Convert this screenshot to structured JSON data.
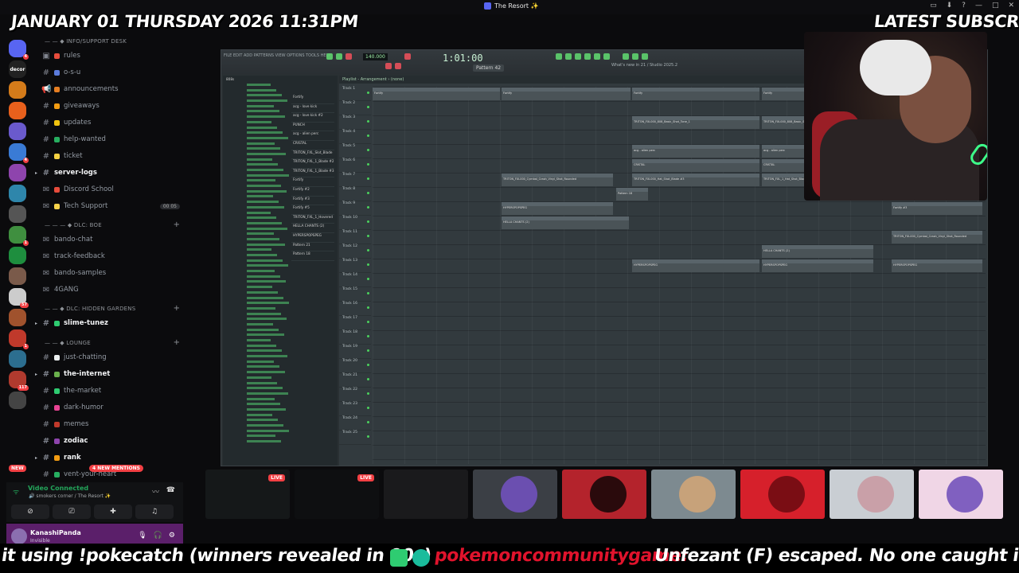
{
  "window": {
    "title": "The Resort ✨"
  },
  "overlay": {
    "datetime": "JANUARY 01 THURSDAY 2026 11:31PM",
    "latest_label": "LATEST SUBSCRI"
  },
  "servers": [
    {
      "icon": "discord-home-icon",
      "color": "#5865f2",
      "badge": "4"
    },
    {
      "icon": "server-decor-icon",
      "color": "#222",
      "label": "decor"
    },
    {
      "icon": "server-gold-icon",
      "color": "#d47b1a"
    },
    {
      "icon": "server-calendar-icon",
      "color": "#e8601c"
    },
    {
      "icon": "server-purple-icon",
      "color": "#6a5acd"
    },
    {
      "icon": "server-blue-icon",
      "color": "#3a7bd5",
      "badge": "4"
    },
    {
      "icon": "server-violet-icon",
      "color": "#8e44ad"
    },
    {
      "icon": "server-teal-icon",
      "color": "#2e86ab"
    },
    {
      "icon": "server-grey-icon",
      "color": "#555"
    },
    {
      "icon": "server-money-icon",
      "color": "#3f8f3f",
      "badge": "1"
    },
    {
      "icon": "server-green-icon",
      "color": "#1e8e3e"
    },
    {
      "icon": "server-face-icon",
      "color": "#7a5a4a"
    },
    {
      "icon": "server-white-icon",
      "color": "#ccc",
      "badge": "57"
    },
    {
      "icon": "server-avatar-icon",
      "color": "#a0522d"
    },
    {
      "icon": "server-fire-icon",
      "color": "#c0392b",
      "badge": "1"
    },
    {
      "icon": "server-ocean-icon",
      "color": "#2c6e8f"
    },
    {
      "icon": "server-game-icon",
      "color": "#b03a2e",
      "badge": "117"
    },
    {
      "icon": "server-dark-icon",
      "color": "#444"
    }
  ],
  "new_pill": "NEW",
  "categories": {
    "info": "INFO/SUPPORT DESK",
    "dlc_boe": "DLC: BOE",
    "dlc_hidden": "DLC: HIDDEN GARDENS",
    "lounge": "LOUNGE"
  },
  "channels": {
    "rules": "rules",
    "osu": "o-s-u",
    "announcements": "announcements",
    "giveaways": "giveaways",
    "updates": "updates",
    "help_wanted": "help-wanted",
    "ticket": "ticket",
    "server_logs": "server-logs",
    "discord_school": "Discord School",
    "tech_support": "Tech Support",
    "tech_support_count": "00 05",
    "bando_chat": "bando-chat",
    "track_feedback": "track-feedback",
    "bando_samples": "bando-samples",
    "fourgang": "4GANG",
    "slime_tunez": "slime-tunez",
    "just_chatting": "just-chatting",
    "the_internet": "the-internet",
    "the_market": "the-market",
    "dark_humor": "dark-humor",
    "memes": "memes",
    "zodiac": "zodiac",
    "rank": "rank",
    "vent": "vent-your-heart"
  },
  "mentions": "4 NEW MENTIONS",
  "voice": {
    "status": "Video Connected",
    "location": "smokers corner / The Resort ✨"
  },
  "user": {
    "name": "KanashiPanda",
    "status": "Invisible"
  },
  "fl": {
    "time": "1:01:00",
    "tempo": "140.000",
    "pattern": "Pattern 42",
    "hint": "What's new in 21 / Studio 2025.2",
    "menu": "FILE EDIT ADD PATTERNS VIEW OPTIONS TOOLS HELP",
    "playlist_title": "Playlist - Arrangement › (none)",
    "browser_header": "808s",
    "tracks": [
      "Track 1",
      "Track 2",
      "Track 3",
      "Track 4",
      "Track 5",
      "Track 6",
      "Track 7",
      "Track 8",
      "Track 9",
      "Track 10",
      "Track 11",
      "Track 12",
      "Track 13",
      "Track 14",
      "Track 15",
      "Track 16",
      "Track 17",
      "Track 18",
      "Track 19",
      "Track 20",
      "Track 21",
      "Track 22",
      "Track 23",
      "Track 24",
      "Track 25"
    ],
    "patterns": [
      "Fortify",
      "acg - love kick",
      "acg - love kick #2",
      "PUNCH",
      "acg - alien perc",
      "CRISTAL",
      "TRITON_FXL_Slot_Blade",
      "TRITON_FXL_1_Blade #2",
      "TRITON_FXL_1_Blade #3",
      "Fortify",
      "Fortify #2",
      "Fortify #3",
      "Fortify #5",
      "TRITON_FXL_1_Hovered",
      "HELLA CHANTS (2)",
      "HYPERSPOPSPEG",
      "Pattern 21",
      "Pattern 18"
    ],
    "clips": [
      {
        "label": "Fortify"
      },
      {
        "label": "Fortify"
      },
      {
        "label": "Fortify"
      },
      {
        "label": "Fortify"
      },
      {
        "label": "TRITON_FXL000_808_Basic_Shot_Tone_1"
      },
      {
        "label": "TRITON_FXL000_808_Basic_Shot_Tone_1"
      },
      {
        "label": "acg - alien perc"
      },
      {
        "label": "acg - alien perc"
      },
      {
        "label": "CRISTAL"
      },
      {
        "label": "CRISTAL"
      },
      {
        "label": "TRITON_FXL000_Cymbal_Crash_Vinyl_Shot_Rounded"
      },
      {
        "label": "TRITON_FXL000_Hat_Shot_Blade #3"
      },
      {
        "label": "TRITON_FXL_1_Hat_Shot_Blade #3"
      },
      {
        "label": "Pattern 18"
      },
      {
        "label": "HYPERSPOPSPEG"
      },
      {
        "label": "HELLA CHANTS (2)"
      },
      {
        "label": "Fortify #3"
      },
      {
        "label": "TRITON_FXL000_Cymbal_Crash_Vinyl_Shot_Rounded"
      },
      {
        "label": "HELLA CHANTS (2)"
      },
      {
        "label": "HYPERSPOPSPEG"
      },
      {
        "label": "HYPERSPOPSPEG"
      },
      {
        "label": "HYPERSPOPSPEG"
      }
    ]
  },
  "tiles": [
    {
      "name": "tile-screen-share",
      "live": "LIVE",
      "bg": "#151819"
    },
    {
      "name": "tile-stream-2",
      "live": "LIVE",
      "bg": "#0e0f11"
    },
    {
      "name": "tile-camera",
      "bg": "#1a1a1c"
    },
    {
      "name": "tile-avatar-gorilla",
      "bg": "#3b3f45",
      "face": "#6b4fb0"
    },
    {
      "name": "tile-avatar-red-hood",
      "bg": "#b4232c",
      "face": "#2a0a0c"
    },
    {
      "name": "tile-avatar-chopper",
      "bg": "#7d8a90",
      "face": "#c7a27a"
    },
    {
      "name": "tile-avatar-red-creature",
      "bg": "#d6202b",
      "face": "#7a0d14"
    },
    {
      "name": "tile-avatar-eye",
      "bg": "#c9ced3",
      "face": "#c9a0a8"
    },
    {
      "name": "tile-avatar-player",
      "bg": "#f0d6e6",
      "face": "#8060c0"
    }
  ],
  "ticker": {
    "part1": "it using !pokecatch (winners revealed in 90s)",
    "part2": "pokemoncommunitygame:",
    "part3": "Unfezant (F) escaped. No one caught it."
  }
}
